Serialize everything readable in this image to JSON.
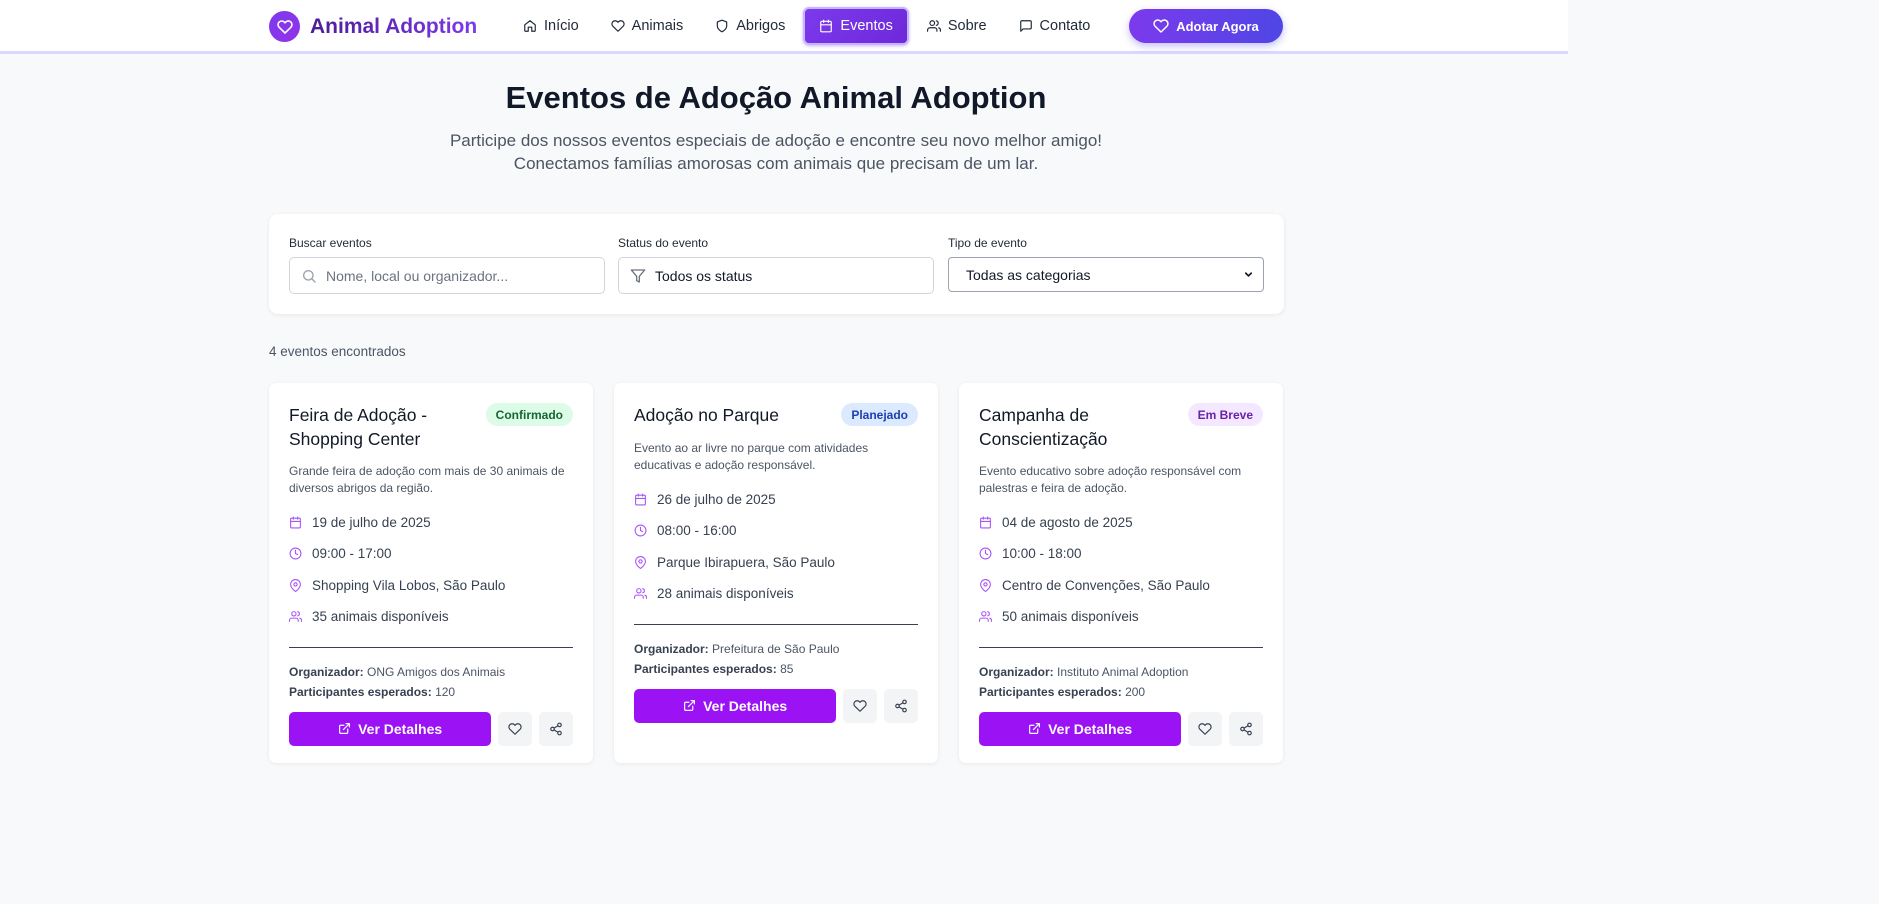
{
  "brand": {
    "name": "Animal Adoption"
  },
  "nav": {
    "items": [
      {
        "label": "Início",
        "icon": "home-icon"
      },
      {
        "label": "Animais",
        "icon": "heart-icon"
      },
      {
        "label": "Abrigos",
        "icon": "shield-icon"
      },
      {
        "label": "Eventos",
        "icon": "calendar-icon",
        "active": true
      },
      {
        "label": "Sobre",
        "icon": "users-icon"
      },
      {
        "label": "Contato",
        "icon": "message-icon"
      }
    ],
    "cta_label": "Adotar Agora"
  },
  "hero": {
    "title": "Eventos de Adoção Animal Adoption",
    "subtitle_line1": "Participe dos nossos eventos especiais de adoção e encontre seu novo melhor amigo!",
    "subtitle_line2": "Conectamos famílias amorosas com animais que precisam de um lar."
  },
  "filters": {
    "search_label": "Buscar eventos",
    "search_placeholder": "Nome, local ou organizador...",
    "status_label": "Status do evento",
    "status_value": "Todos os status",
    "type_label": "Tipo de evento",
    "type_value": "Todas as categorias"
  },
  "results_count": "4 eventos encontrados",
  "labels": {
    "organizer": "Organizador:",
    "participants": "Participantes esperados:",
    "details_button": "Ver Detalhes"
  },
  "colors": {
    "accent": "#7c3aed",
    "button": "#9b12f5",
    "icon": "#a855f7"
  },
  "events": [
    {
      "title": "Feira de Adoção - Shopping Center",
      "status": "Confirmado",
      "description": "Grande feira de adoção com mais de 30 animais de diversos abrigos da região.",
      "date": "19 de julho de 2025",
      "time": "09:00 - 17:00",
      "location": "Shopping Vila Lobos, São Paulo",
      "animals": "35 animais disponíveis",
      "organizer": "ONG Amigos dos Animais",
      "participants": "120"
    },
    {
      "title": "Adoção no Parque",
      "status": "Planejado",
      "description": "Evento ao ar livre no parque com atividades educativas e adoção responsável.",
      "date": "26 de julho de 2025",
      "time": "08:00 - 16:00",
      "location": "Parque Ibirapuera, São Paulo",
      "animals": "28 animais disponíveis",
      "organizer": "Prefeitura de São Paulo",
      "participants": "85"
    },
    {
      "title": "Campanha de Conscientização",
      "status": "Em Breve",
      "description": "Evento educativo sobre adoção responsável com palestras e feira de adoção.",
      "date": "04 de agosto de 2025",
      "time": "10:00 - 18:00",
      "location": "Centro de Convenções, São Paulo",
      "animals": "50 animais disponíveis",
      "organizer": "Instituto Animal Adoption",
      "participants": "200"
    }
  ]
}
